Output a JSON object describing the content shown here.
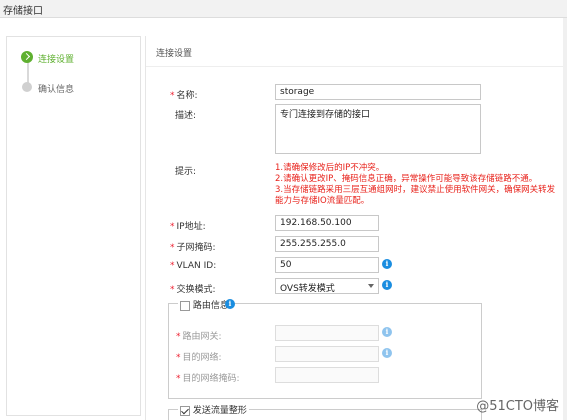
{
  "window": {
    "title": "存储接口"
  },
  "steps": [
    {
      "label": "连接设置",
      "state": "active"
    },
    {
      "label": "确认信息",
      "state": "idle"
    }
  ],
  "section": {
    "title": "连接设置"
  },
  "form": {
    "name": {
      "label": "名称:",
      "value": "storage",
      "required": true
    },
    "desc": {
      "label": "描述:",
      "value": "专门连接到存储的接口"
    },
    "tips": {
      "label": "提示:",
      "lines": [
        "1.请确保修改后的IP不冲突。",
        "2.请确认更改IP、掩码信息正确，异常操作可能导致该存储链路不通。",
        "3.当存储链路采用三层互通组网时，建议禁止使用软件网关，确保网关转发",
        "能力与存储IO流量匹配。"
      ]
    },
    "ip": {
      "label": "IP地址:",
      "value": "192.168.50.100",
      "required": true
    },
    "mask": {
      "label": "子网掩码:",
      "value": "255.255.255.0",
      "required": true
    },
    "vlan": {
      "label": "VLAN ID:",
      "value": "50",
      "required": true
    },
    "mode": {
      "label": "交换模式:",
      "value": "OVS转发模式",
      "required": true
    },
    "route": {
      "legend": "路由信息",
      "checked": false,
      "gateway": {
        "label": "路由网关:",
        "value": ""
      },
      "dest": {
        "label": "目的网络:",
        "value": ""
      },
      "destmask": {
        "label": "目的网络掩码:",
        "value": ""
      }
    },
    "traffic": {
      "legend": "发送流量整形",
      "checked": true
    }
  },
  "watermark": "@51CTO博客",
  "colors": {
    "accent": "#5fb030",
    "warning": "#e8221b",
    "info": "#1a8de0"
  },
  "icons": {
    "info": "info-circle-icon",
    "check": "check-icon"
  }
}
